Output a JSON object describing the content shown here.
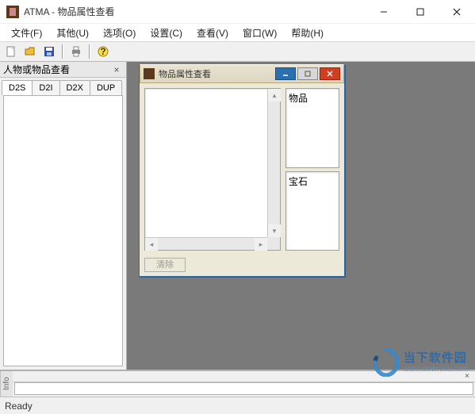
{
  "window": {
    "title": "ATMA - 物品属性查看"
  },
  "menubar": {
    "items": [
      "文件(F)",
      "其他(U)",
      "选项(O)",
      "设置(C)",
      "查看(V)",
      "窗口(W)",
      "帮助(H)"
    ]
  },
  "toolbar": {
    "icons": [
      "new-icon",
      "open-icon",
      "save-icon",
      "print-icon",
      "help-icon"
    ]
  },
  "left_dock": {
    "title": "人物或物品查看",
    "tabs": [
      "D2S",
      "D2I",
      "D2X",
      "DUP"
    ],
    "active_tab_index": 0
  },
  "child_window": {
    "title": "物品属性查看",
    "right_labels": {
      "top": "物品",
      "bottom": "宝石"
    },
    "delete_label": "清除"
  },
  "info_dock": {
    "label": "Info"
  },
  "statusbar": {
    "text": "Ready"
  },
  "watermark": {
    "top": "当下软件园",
    "bottom": "www.downxia.com"
  }
}
